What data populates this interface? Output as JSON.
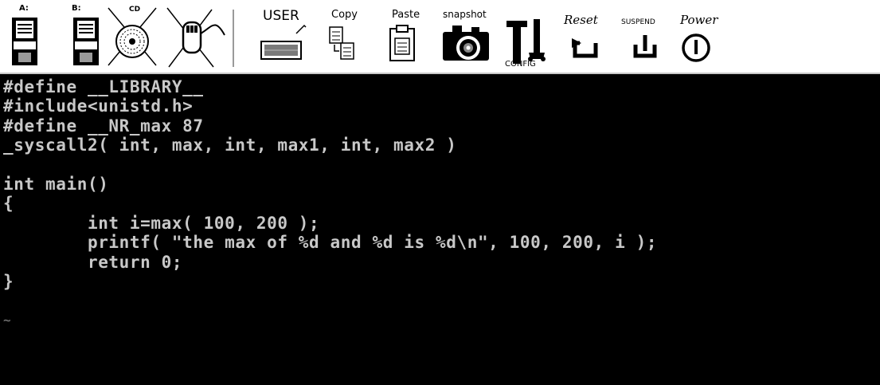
{
  "toolbar": {
    "buttons": [
      {
        "id": "floppy-a",
        "label": "A:",
        "icon": "floppy-disk-icon"
      },
      {
        "id": "floppy-b",
        "label": "B:",
        "icon": "floppy-disk-icon"
      },
      {
        "id": "cdrom",
        "label": "CD",
        "icon": "cdrom-icon"
      },
      {
        "id": "mouse",
        "label": "",
        "icon": "mouse-capture-icon"
      },
      {
        "id": "user",
        "label": "USER",
        "icon": "keyboard-icon"
      },
      {
        "id": "copy",
        "label": "Copy",
        "icon": "copy-icon"
      },
      {
        "id": "paste",
        "label": "Paste",
        "icon": "paste-icon"
      },
      {
        "id": "snapshot",
        "label": "snapshot",
        "icon": "camera-icon"
      },
      {
        "id": "config",
        "label": "CONFIG",
        "icon": "config-tools-icon"
      },
      {
        "id": "reset",
        "label": "Reset",
        "icon": "reset-icon"
      },
      {
        "id": "suspend",
        "label": "SUSPEND",
        "icon": "suspend-icon"
      },
      {
        "id": "power",
        "label": "Power",
        "icon": "power-icon"
      }
    ]
  },
  "terminal": {
    "lines": [
      "#define __LIBRARY__",
      "#include<unistd.h>",
      "#define __NR_max 87",
      "_syscall2( int, max, int, max1, int, max2 )",
      "",
      "int main()",
      "{",
      "        int i=max( 100, 200 );",
      "        printf( \"the max of %d and %d is %d\\n\", 100, 200, i );",
      "        return 0;",
      "}",
      "",
      "~"
    ]
  },
  "colors": {
    "terminal_bg": "#000000",
    "terminal_fg": "#c8c8c8",
    "toolbar_bg": "#ffffff"
  }
}
